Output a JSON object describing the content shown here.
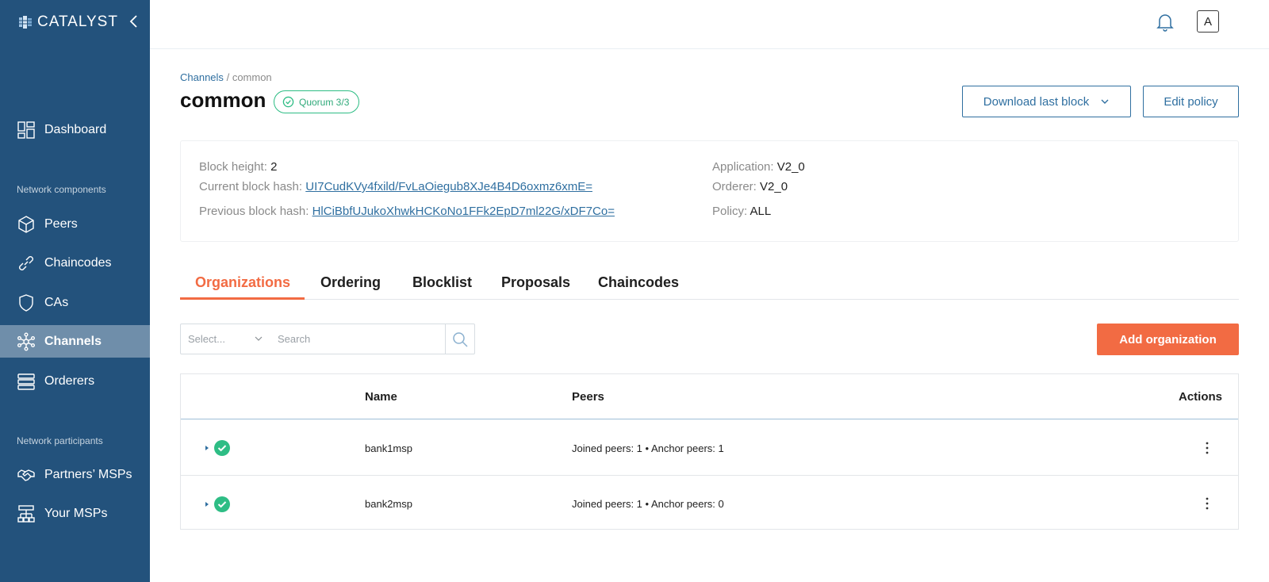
{
  "app": {
    "logo_text": "CATALYST"
  },
  "sidebar": {
    "items": [
      {
        "label": "Dashboard"
      },
      {
        "label": "Peers"
      },
      {
        "label": "Chaincodes"
      },
      {
        "label": "CAs"
      },
      {
        "label": "Channels"
      },
      {
        "label": "Orderers"
      },
      {
        "label": "Partners’ MSPs"
      },
      {
        "label": "Your MSPs"
      }
    ],
    "sections": {
      "network_components": "Network components",
      "network_participants": "Network participants"
    },
    "active_item": "Channels"
  },
  "topbar": {
    "avatar_letter": "A"
  },
  "breadcrumb": {
    "parent": "Channels",
    "separator": "/",
    "current": "common"
  },
  "page": {
    "title": "common",
    "quorum_badge": "Quorum 3/3"
  },
  "actions": {
    "download_label": "Download last block",
    "edit_label": "Edit policy"
  },
  "info": {
    "block_height_label": "Block height:",
    "block_height": "2",
    "current_hash_label": "Current block hash:",
    "current_hash": "UI7CudKVy4fxild/FvLaOiegub8XJe4B4D6oxmz6xmE=",
    "previous_hash_label": "Previous block hash:",
    "previous_hash": "HlCiBbfUJukoXhwkHCKoNo1FFk2EpD7ml22G/xDF7Co=",
    "application_label": "Application:",
    "application": "V2_0",
    "orderer_label": "Orderer:",
    "orderer": "V2_0",
    "policy_label": "Policy:",
    "policy": "ALL"
  },
  "tabs": [
    {
      "label": "Organizations"
    },
    {
      "label": "Ordering"
    },
    {
      "label": "Blocklist"
    },
    {
      "label": "Proposals"
    },
    {
      "label": "Chaincodes"
    }
  ],
  "filters": {
    "select_placeholder": "Select...",
    "search_placeholder": "Search"
  },
  "add_org_label": "Add organization",
  "table": {
    "headers": {
      "name": "Name",
      "peers": "Peers",
      "actions": "Actions"
    },
    "rows": [
      {
        "name": "bank1msp",
        "peers": "Joined peers: 1 • Anchor peers: 1",
        "status": "ok"
      },
      {
        "name": "bank2msp",
        "peers": "Joined peers: 1 • Anchor peers: 0",
        "status": "ok"
      }
    ]
  },
  "colors": {
    "sidebar": "#23527c",
    "sidebar_active": "#6f8eaa",
    "accent": "#f26b43",
    "link": "#2f6fa0",
    "success": "#2ebd85"
  }
}
